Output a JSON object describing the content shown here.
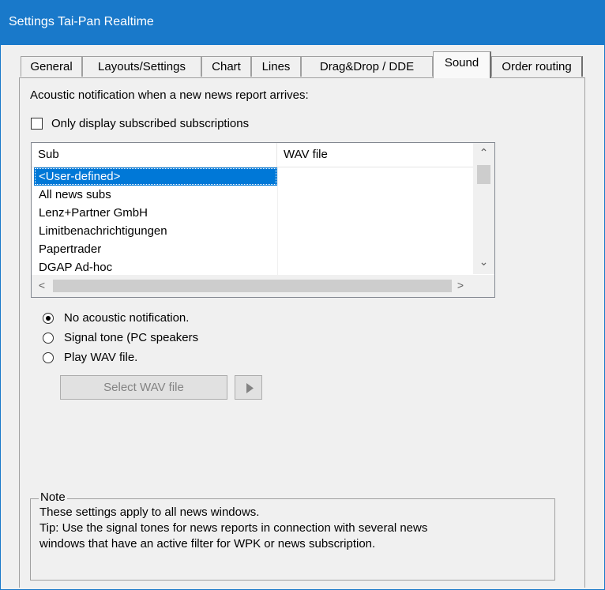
{
  "window": {
    "title": "Settings Tai-Pan Realtime"
  },
  "tabs": [
    {
      "label": "General",
      "active": false
    },
    {
      "label": "Layouts/Settings",
      "active": false
    },
    {
      "label": "Chart",
      "active": false
    },
    {
      "label": "Lines",
      "active": false
    },
    {
      "label": "Drag&Drop / DDE",
      "active": false
    },
    {
      "label": "Sound",
      "active": true
    },
    {
      "label": "Order routing",
      "active": false
    }
  ],
  "sound": {
    "description": "Acoustic notification when a new news report arrives:",
    "only_subscribed_label": "Only display subscribed subscriptions",
    "only_subscribed_checked": false,
    "table": {
      "columns": [
        "Sub",
        "WAV file"
      ],
      "rows": [
        {
          "sub": "<User-defined>",
          "wav": "",
          "selected": true
        },
        {
          "sub": "All news subs",
          "wav": "",
          "selected": false
        },
        {
          "sub": "Lenz+Partner GmbH",
          "wav": "",
          "selected": false
        },
        {
          "sub": "Limitbenachrichtigungen",
          "wav": "",
          "selected": false
        },
        {
          "sub": "Papertrader",
          "wav": "",
          "selected": false
        },
        {
          "sub": "DGAP Ad-hoc",
          "wav": "",
          "selected": false
        }
      ]
    },
    "options": [
      {
        "label": "No acoustic notification.",
        "checked": true
      },
      {
        "label": "Signal tone (PC speakers",
        "checked": false
      },
      {
        "label": "Play WAV file.",
        "checked": false
      }
    ],
    "select_wav_label": "Select WAV file",
    "play_icon": "play-icon"
  },
  "note": {
    "legend": "Note",
    "lines": [
      "These settings apply to all news windows.",
      "Tip: Use the signal tones for news reports in connection with several news",
      "windows that have an active filter for WPK or news subscription."
    ]
  },
  "colors": {
    "titlebar": "#1979ca",
    "selection": "#0078d7"
  }
}
